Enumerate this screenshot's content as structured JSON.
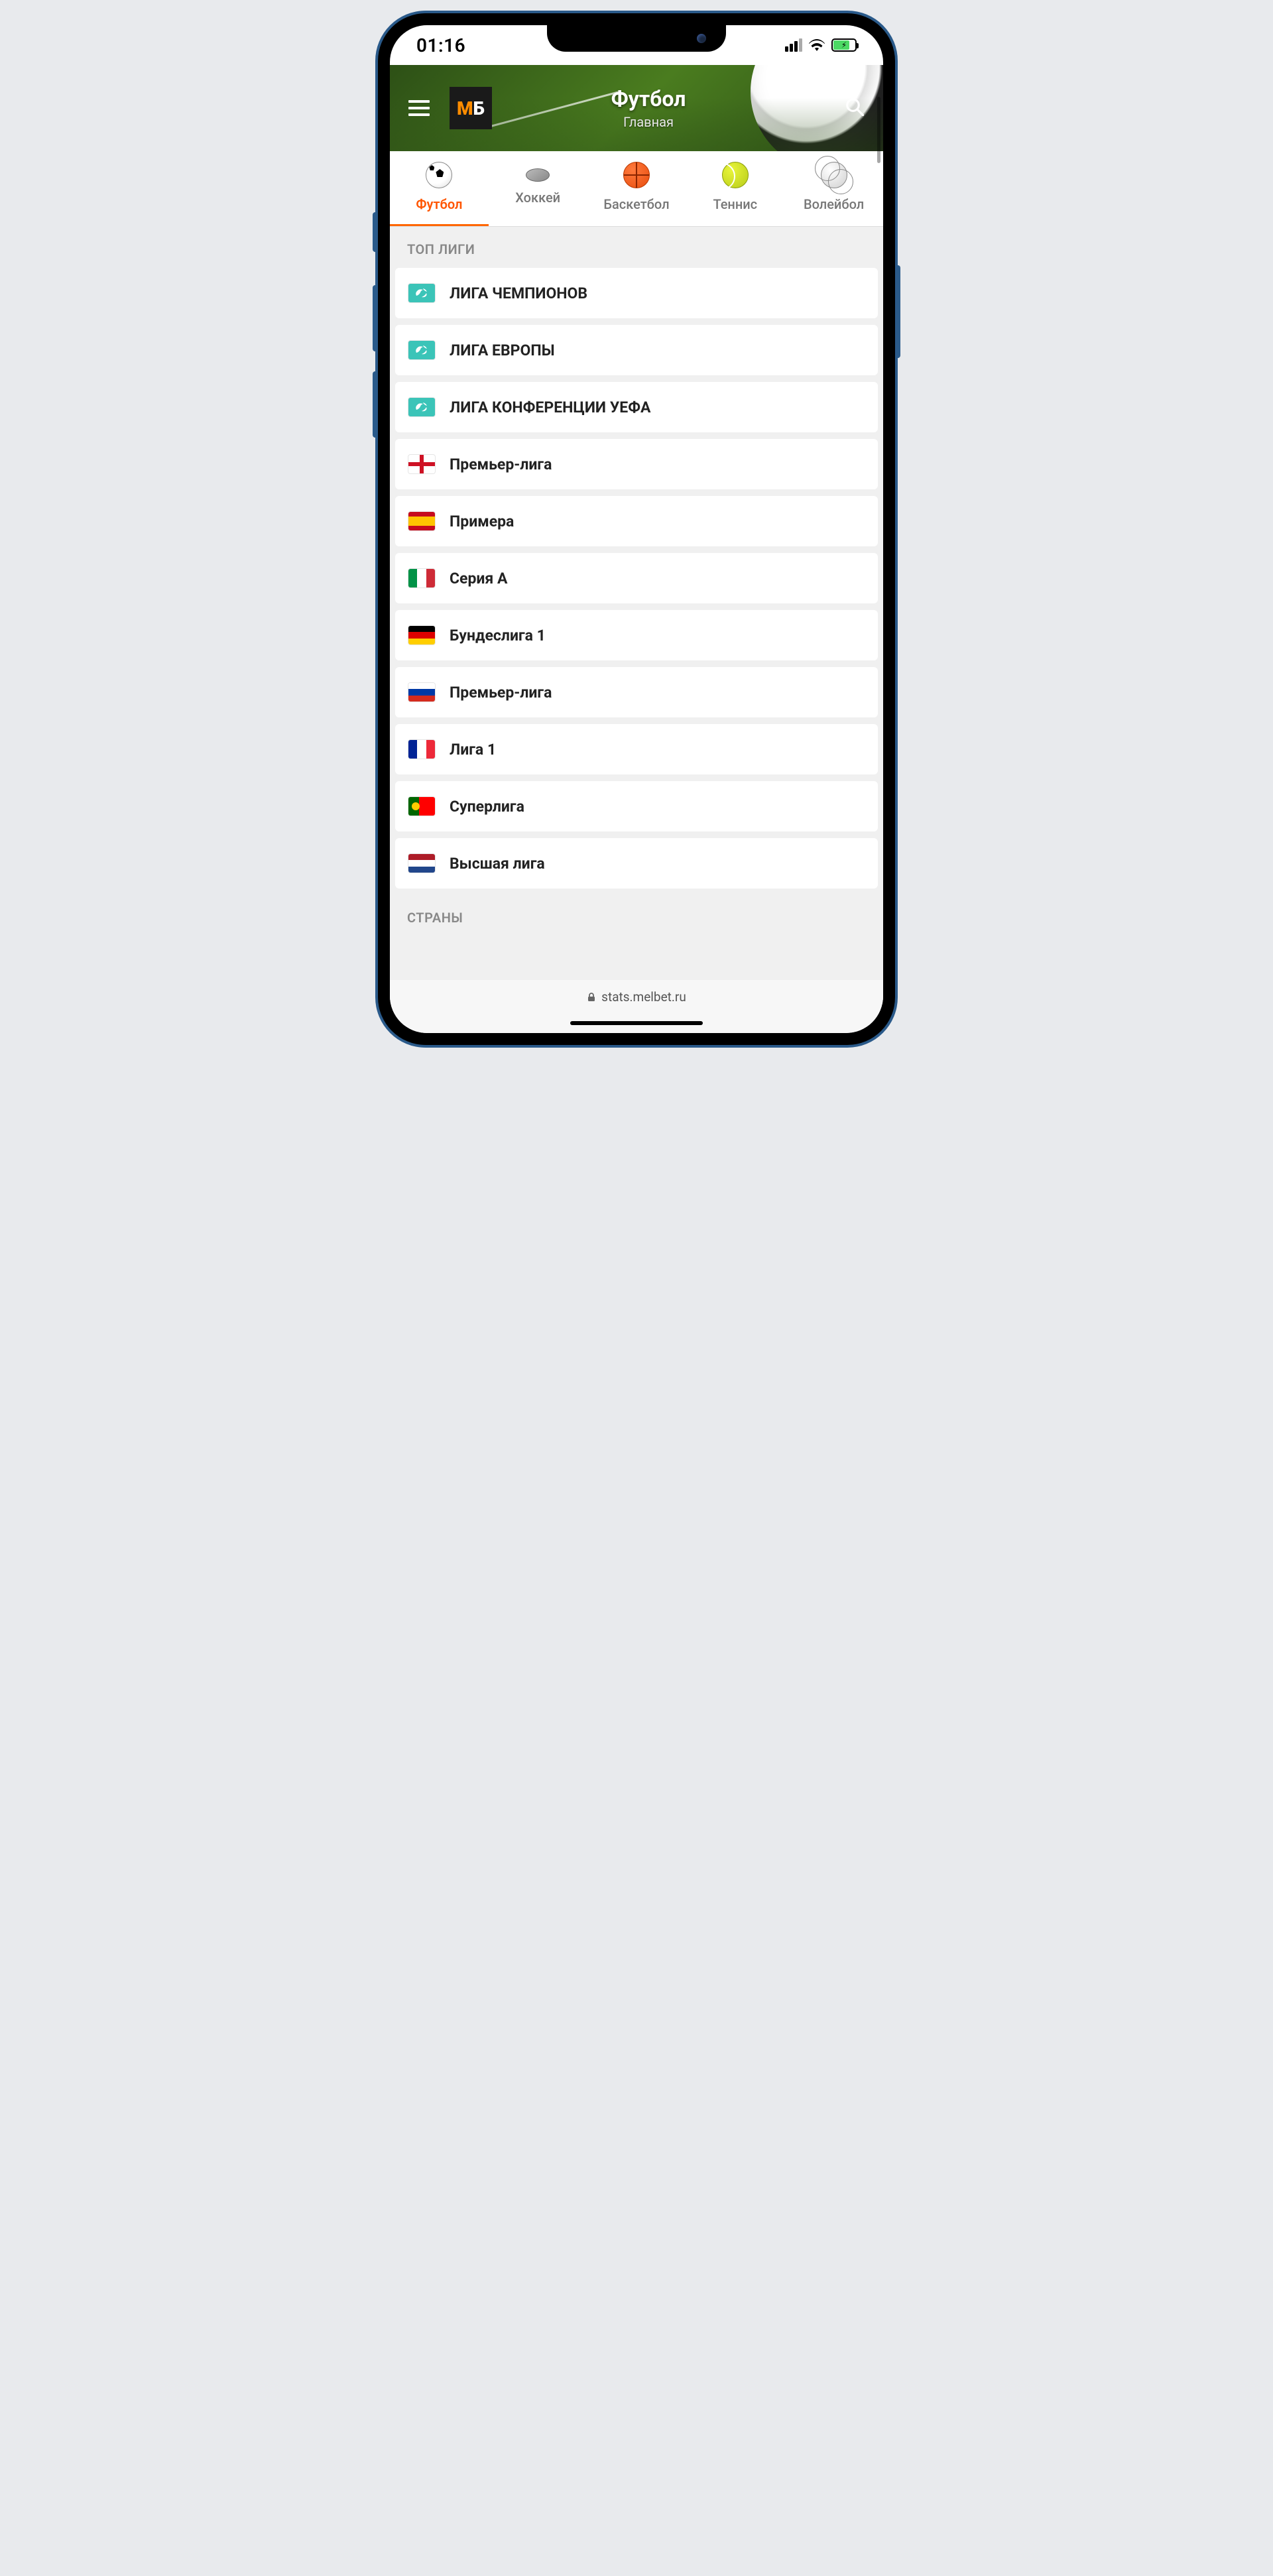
{
  "status": {
    "time": "01:16"
  },
  "header": {
    "title": "Футбол",
    "subtitle": "Главная"
  },
  "tabs": [
    {
      "label": "Футбол",
      "icon": "soccer",
      "active": true
    },
    {
      "label": "Хоккей",
      "icon": "hockey",
      "active": false
    },
    {
      "label": "Баскетбол",
      "icon": "basketball",
      "active": false
    },
    {
      "label": "Теннис",
      "icon": "tennis",
      "active": false
    },
    {
      "label": "Волейбол",
      "icon": "volleyball",
      "active": false
    }
  ],
  "section_top": "ТОП ЛИГИ",
  "leagues": [
    {
      "flag": "uefa",
      "name": "ЛИГА ЧЕМПИОНОВ"
    },
    {
      "flag": "uefa",
      "name": "ЛИГА ЕВРОПЫ"
    },
    {
      "flag": "uefa",
      "name": "ЛИГА КОНФЕРЕНЦИИ УЕФА"
    },
    {
      "flag": "eng",
      "name": "Премьер-лига"
    },
    {
      "flag": "esp",
      "name": "Примера"
    },
    {
      "flag": "ita",
      "name": "Серия А"
    },
    {
      "flag": "ger",
      "name": "Бундеслига 1"
    },
    {
      "flag": "rus",
      "name": "Премьер-лига"
    },
    {
      "flag": "fra",
      "name": "Лига 1"
    },
    {
      "flag": "por",
      "name": "Суперлига"
    },
    {
      "flag": "ned",
      "name": "Высшая лига"
    }
  ],
  "section_countries": "СТРАНЫ",
  "footer": {
    "url": "stats.melbet.ru"
  }
}
